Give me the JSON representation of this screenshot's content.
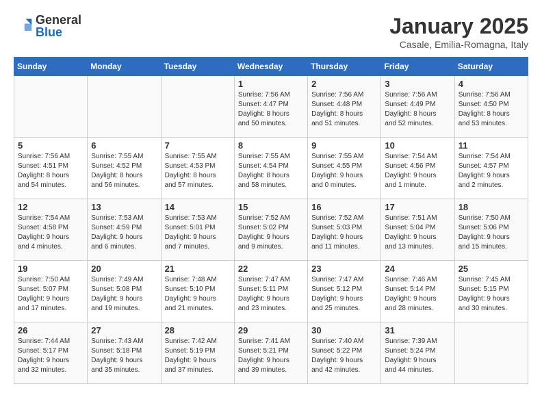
{
  "header": {
    "logo_general": "General",
    "logo_blue": "Blue",
    "month_title": "January 2025",
    "location": "Casale, Emilia-Romagna, Italy"
  },
  "days_of_week": [
    "Sunday",
    "Monday",
    "Tuesday",
    "Wednesday",
    "Thursday",
    "Friday",
    "Saturday"
  ],
  "weeks": [
    [
      {
        "day": "",
        "info": ""
      },
      {
        "day": "",
        "info": ""
      },
      {
        "day": "",
        "info": ""
      },
      {
        "day": "1",
        "info": "Sunrise: 7:56 AM\nSunset: 4:47 PM\nDaylight: 8 hours\nand 50 minutes."
      },
      {
        "day": "2",
        "info": "Sunrise: 7:56 AM\nSunset: 4:48 PM\nDaylight: 8 hours\nand 51 minutes."
      },
      {
        "day": "3",
        "info": "Sunrise: 7:56 AM\nSunset: 4:49 PM\nDaylight: 8 hours\nand 52 minutes."
      },
      {
        "day": "4",
        "info": "Sunrise: 7:56 AM\nSunset: 4:50 PM\nDaylight: 8 hours\nand 53 minutes."
      }
    ],
    [
      {
        "day": "5",
        "info": "Sunrise: 7:56 AM\nSunset: 4:51 PM\nDaylight: 8 hours\nand 54 minutes."
      },
      {
        "day": "6",
        "info": "Sunrise: 7:55 AM\nSunset: 4:52 PM\nDaylight: 8 hours\nand 56 minutes."
      },
      {
        "day": "7",
        "info": "Sunrise: 7:55 AM\nSunset: 4:53 PM\nDaylight: 8 hours\nand 57 minutes."
      },
      {
        "day": "8",
        "info": "Sunrise: 7:55 AM\nSunset: 4:54 PM\nDaylight: 8 hours\nand 58 minutes."
      },
      {
        "day": "9",
        "info": "Sunrise: 7:55 AM\nSunset: 4:55 PM\nDaylight: 9 hours\nand 0 minutes."
      },
      {
        "day": "10",
        "info": "Sunrise: 7:54 AM\nSunset: 4:56 PM\nDaylight: 9 hours\nand 1 minute."
      },
      {
        "day": "11",
        "info": "Sunrise: 7:54 AM\nSunset: 4:57 PM\nDaylight: 9 hours\nand 2 minutes."
      }
    ],
    [
      {
        "day": "12",
        "info": "Sunrise: 7:54 AM\nSunset: 4:58 PM\nDaylight: 9 hours\nand 4 minutes."
      },
      {
        "day": "13",
        "info": "Sunrise: 7:53 AM\nSunset: 4:59 PM\nDaylight: 9 hours\nand 6 minutes."
      },
      {
        "day": "14",
        "info": "Sunrise: 7:53 AM\nSunset: 5:01 PM\nDaylight: 9 hours\nand 7 minutes."
      },
      {
        "day": "15",
        "info": "Sunrise: 7:52 AM\nSunset: 5:02 PM\nDaylight: 9 hours\nand 9 minutes."
      },
      {
        "day": "16",
        "info": "Sunrise: 7:52 AM\nSunset: 5:03 PM\nDaylight: 9 hours\nand 11 minutes."
      },
      {
        "day": "17",
        "info": "Sunrise: 7:51 AM\nSunset: 5:04 PM\nDaylight: 9 hours\nand 13 minutes."
      },
      {
        "day": "18",
        "info": "Sunrise: 7:50 AM\nSunset: 5:06 PM\nDaylight: 9 hours\nand 15 minutes."
      }
    ],
    [
      {
        "day": "19",
        "info": "Sunrise: 7:50 AM\nSunset: 5:07 PM\nDaylight: 9 hours\nand 17 minutes."
      },
      {
        "day": "20",
        "info": "Sunrise: 7:49 AM\nSunset: 5:08 PM\nDaylight: 9 hours\nand 19 minutes."
      },
      {
        "day": "21",
        "info": "Sunrise: 7:48 AM\nSunset: 5:10 PM\nDaylight: 9 hours\nand 21 minutes."
      },
      {
        "day": "22",
        "info": "Sunrise: 7:47 AM\nSunset: 5:11 PM\nDaylight: 9 hours\nand 23 minutes."
      },
      {
        "day": "23",
        "info": "Sunrise: 7:47 AM\nSunset: 5:12 PM\nDaylight: 9 hours\nand 25 minutes."
      },
      {
        "day": "24",
        "info": "Sunrise: 7:46 AM\nSunset: 5:14 PM\nDaylight: 9 hours\nand 28 minutes."
      },
      {
        "day": "25",
        "info": "Sunrise: 7:45 AM\nSunset: 5:15 PM\nDaylight: 9 hours\nand 30 minutes."
      }
    ],
    [
      {
        "day": "26",
        "info": "Sunrise: 7:44 AM\nSunset: 5:17 PM\nDaylight: 9 hours\nand 32 minutes."
      },
      {
        "day": "27",
        "info": "Sunrise: 7:43 AM\nSunset: 5:18 PM\nDaylight: 9 hours\nand 35 minutes."
      },
      {
        "day": "28",
        "info": "Sunrise: 7:42 AM\nSunset: 5:19 PM\nDaylight: 9 hours\nand 37 minutes."
      },
      {
        "day": "29",
        "info": "Sunrise: 7:41 AM\nSunset: 5:21 PM\nDaylight: 9 hours\nand 39 minutes."
      },
      {
        "day": "30",
        "info": "Sunrise: 7:40 AM\nSunset: 5:22 PM\nDaylight: 9 hours\nand 42 minutes."
      },
      {
        "day": "31",
        "info": "Sunrise: 7:39 AM\nSunset: 5:24 PM\nDaylight: 9 hours\nand 44 minutes."
      },
      {
        "day": "",
        "info": ""
      }
    ]
  ]
}
